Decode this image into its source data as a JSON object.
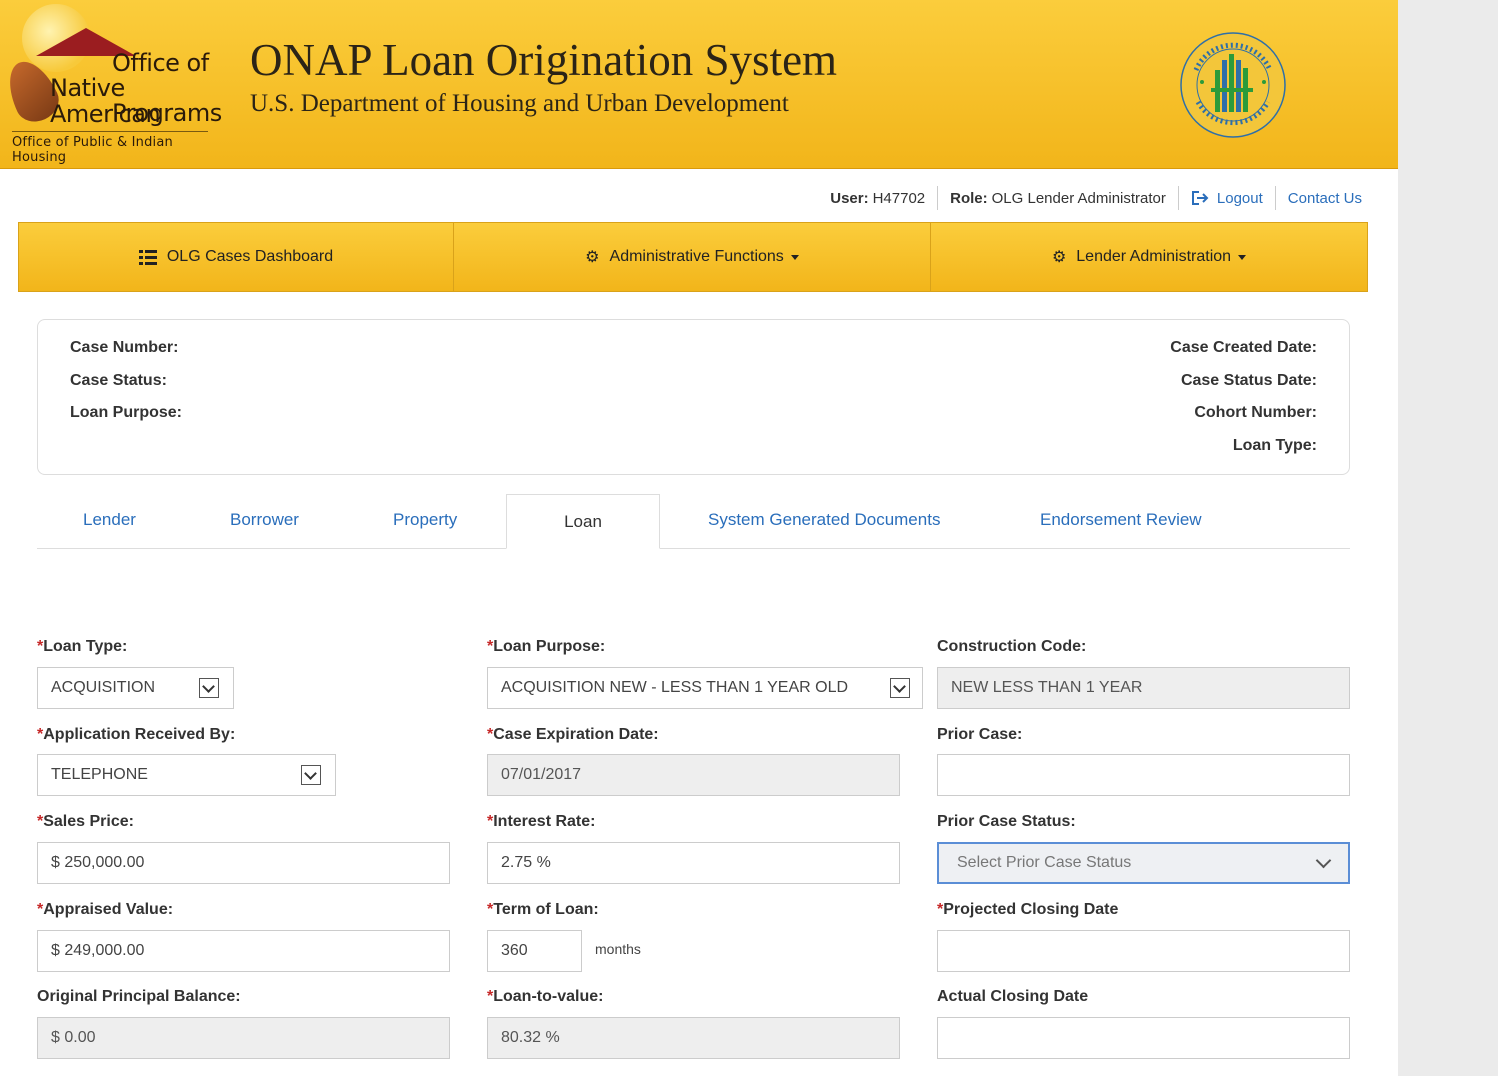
{
  "header": {
    "logo_line1": "Office of",
    "logo_line2": "Native American",
    "logo_line3": "Programs",
    "logo_subline": "Office of Public & Indian Housing",
    "title": "ONAP Loan Origination System",
    "subtitle": "U.S. Department of Housing and Urban Development",
    "seal_icon": "hud-seal-icon"
  },
  "userbar": {
    "user_label": "User:",
    "user_value": "H47702",
    "role_label": "Role:",
    "role_value": "OLG Lender Administrator",
    "logout": "Logout",
    "contact": "Contact Us"
  },
  "nav": {
    "dashboard": "OLG Cases Dashboard",
    "admin": "Administrative Functions",
    "lender_admin": "Lender Administration"
  },
  "summary": {
    "case_number": "Case Number:",
    "case_status": "Case Status:",
    "loan_purpose": "Loan Purpose:",
    "case_created_date": "Case Created Date:",
    "case_status_date": "Case Status Date:",
    "cohort_number": "Cohort Number:",
    "loan_type": "Loan Type:"
  },
  "tabs": {
    "lender": "Lender",
    "borrower": "Borrower",
    "property": "Property",
    "loan": "Loan",
    "docs": "System Generated Documents",
    "endorsement": "Endorsement Review"
  },
  "form": {
    "required_mark": "*",
    "loan_type_label": "Loan Type:",
    "loan_type_value": "ACQUISITION",
    "loan_purpose_label": "Loan Purpose:",
    "loan_purpose_value": "ACQUISITION NEW - LESS THAN 1 YEAR OLD",
    "construction_code_label": "Construction Code:",
    "construction_code_value": "NEW LESS THAN 1 YEAR",
    "app_received_label": "Application Received By:",
    "app_received_value": "TELEPHONE",
    "case_expiration_label": "Case Expiration Date:",
    "case_expiration_value": "07/01/2017",
    "prior_case_label": "Prior Case:",
    "prior_case_value": "",
    "sales_price_label": "Sales Price:",
    "sales_price_value": "$ 250,000.00",
    "interest_rate_label": "Interest Rate:",
    "interest_rate_value": "2.75 %",
    "prior_case_status_label": "Prior Case Status:",
    "prior_case_status_placeholder": "Select Prior Case Status",
    "appraised_value_label": "Appraised Value:",
    "appraised_value_value": "$ 249,000.00",
    "term_label": "Term of Loan:",
    "term_value": "360",
    "term_unit": "months",
    "projected_closing_label": "Projected Closing Date",
    "projected_closing_value": "",
    "opb_label": "Original Principal Balance:",
    "opb_value": "$ 0.00",
    "ltv_label": "Loan-to-value:",
    "ltv_value": "80.32 %",
    "actual_closing_label": "Actual Closing Date",
    "actual_closing_value": ""
  },
  "colors": {
    "header_gold": "#f5bd22",
    "link_blue": "#2a6ebb",
    "required_red": "#c62828"
  }
}
